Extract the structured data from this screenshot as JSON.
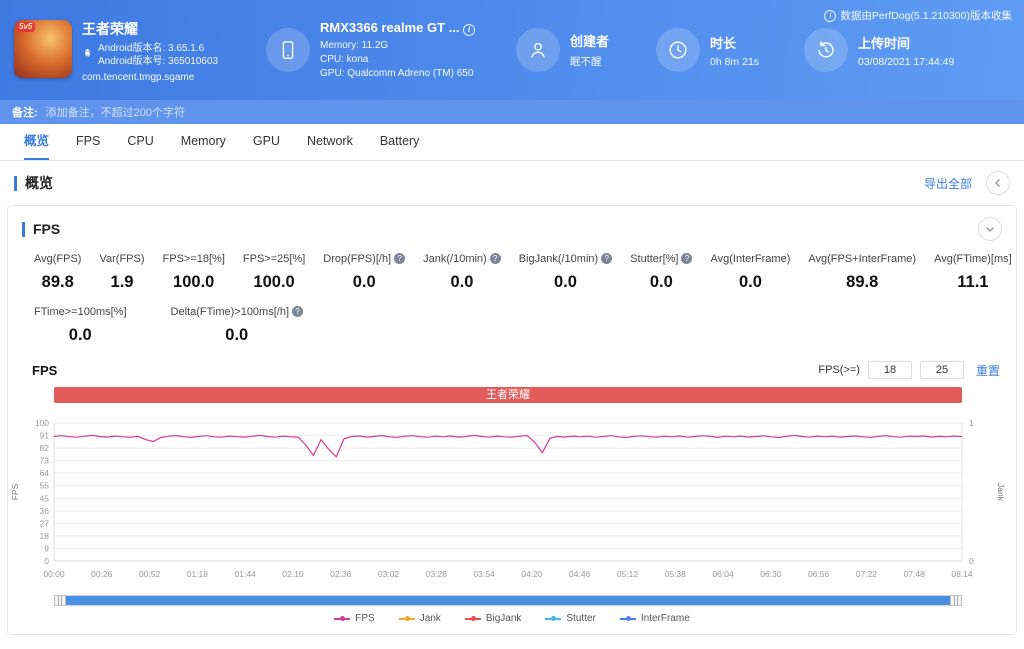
{
  "header": {
    "app": {
      "name": "王者荣耀",
      "badge": "5v5",
      "version_name": "Android版本名: 3.65.1.6",
      "version_code": "Android版本号: 365010603",
      "package": "com.tencent.tmgp.sgame"
    },
    "device": {
      "model": "RMX3366 realme GT ...",
      "memory": "Memory: 11.2G",
      "cpu": "CPU: kona",
      "gpu": "GPU: Qualcomm Adreno (TM) 650"
    },
    "creator": {
      "label": "创建者",
      "value": "眠不醒"
    },
    "duration": {
      "label": "时长",
      "value": "0h 8m 21s"
    },
    "upload": {
      "label": "上传时间",
      "value": "03/08/2021 17:44:49"
    },
    "collect_note": "数据由PerfDog(5.1.210300)版本收集"
  },
  "note_bar": {
    "label": "备注:",
    "placeholder": "添加备注，不超过200个字符"
  },
  "tabs": [
    "概览",
    "FPS",
    "CPU",
    "Memory",
    "GPU",
    "Network",
    "Battery"
  ],
  "overview": {
    "title": "概览",
    "export_all": "导出全部"
  },
  "fps_section": {
    "title": "FPS",
    "chart_label": "FPS",
    "threshold": {
      "label": "FPS(>=)",
      "value1": "18",
      "value2": "25",
      "reset": "重置"
    },
    "stats": [
      {
        "label": "Avg(FPS)",
        "value": "89.8",
        "info": false
      },
      {
        "label": "Var(FPS)",
        "value": "1.9",
        "info": false
      },
      {
        "label": "FPS>=18[%]",
        "value": "100.0",
        "info": false
      },
      {
        "label": "FPS>=25[%]",
        "value": "100.0",
        "info": false
      },
      {
        "label": "Drop(FPS)[/h]",
        "value": "0.0",
        "info": true
      },
      {
        "label": "Jank(/10min)",
        "value": "0.0",
        "info": true
      },
      {
        "label": "BigJank(/10min)",
        "value": "0.0",
        "info": true
      },
      {
        "label": "Stutter[%]",
        "value": "0.0",
        "info": true
      },
      {
        "label": "Avg(InterFrame)",
        "value": "0.0",
        "info": false
      },
      {
        "label": "Avg(FPS+InterFrame)",
        "value": "89.8",
        "info": false
      },
      {
        "label": "Avg(FTime)[ms]",
        "value": "11.1",
        "info": false
      }
    ],
    "stats_row2": [
      {
        "label": "FTime>=100ms[%]",
        "value": "0.0",
        "info": false
      },
      {
        "label": "Delta(FTime)>100ms[/h]",
        "value": "0.0",
        "info": true
      }
    ]
  },
  "chart_data": {
    "type": "line",
    "title": "王者荣耀",
    "ylabel": "FPS",
    "y2label": "Jank",
    "ylim": [
      0,
      100
    ],
    "yticks": [
      "100",
      "91",
      "82",
      "73",
      "64",
      "55",
      "45",
      "36",
      "27",
      "18",
      "9",
      "0"
    ],
    "y2ticks": [
      "1",
      "0"
    ],
    "xticks": [
      "00:00",
      "00:26",
      "00:52",
      "01:18",
      "01:44",
      "02:10",
      "02:36",
      "03:02",
      "03:28",
      "03:54",
      "04:20",
      "04:46",
      "05:12",
      "05:38",
      "06:04",
      "06:30",
      "06:56",
      "07:22",
      "07:48",
      "08:14"
    ],
    "legend": [
      {
        "name": "FPS",
        "color": "#d63a9b"
      },
      {
        "name": "Jank",
        "color": "#f5a623"
      },
      {
        "name": "BigJank",
        "color": "#e64c4c"
      },
      {
        "name": "Stutter",
        "color": "#43b6e8"
      },
      {
        "name": "InterFrame",
        "color": "#4a7ef5"
      }
    ],
    "series": [
      {
        "name": "FPS",
        "color": "#d63a9b",
        "values": [
          90.2,
          90.8,
          90.1,
          89.7,
          90.4,
          91.0,
          90.2,
          89.8,
          90.5,
          90.0,
          89.7,
          90.3,
          88.0,
          86.5,
          89.5,
          90.4,
          90.9,
          90.1,
          89.6,
          90.3,
          90.8,
          90.0,
          89.7,
          90.5,
          90.1,
          89.8,
          90.4,
          91.0,
          90.2,
          89.7,
          90.5,
          90.0,
          89.8,
          84.0,
          76.5,
          88.0,
          81.0,
          75.5,
          88.5,
          90.2,
          90.6,
          89.8,
          90.3,
          90.9,
          90.0,
          89.6,
          90.4,
          90.8,
          90.1,
          89.7,
          90.4,
          90.0,
          90.6,
          89.8,
          90.2,
          91.0,
          90.3,
          89.7,
          90.5,
          90.0,
          89.8,
          90.4,
          90.9,
          86.0,
          78.5,
          89.0,
          90.3,
          89.8,
          90.5,
          90.0,
          90.4,
          89.7,
          90.2,
          90.8,
          90.0,
          89.5,
          90.3,
          90.7,
          90.1,
          89.8,
          90.4,
          90.0,
          90.6,
          89.7,
          90.2,
          90.8,
          90.3,
          89.6,
          90.4,
          90.0,
          90.5,
          89.8,
          90.2,
          90.7,
          90.0,
          89.5,
          90.3,
          91.0,
          90.2,
          89.7,
          90.5,
          90.0,
          90.4,
          89.8,
          90.2,
          90.6,
          90.0,
          89.6,
          90.3,
          90.8,
          90.1,
          89.7,
          90.4,
          90.2,
          90.6,
          89.8,
          90.3,
          90.0,
          90.5,
          90.1
        ]
      }
    ]
  }
}
